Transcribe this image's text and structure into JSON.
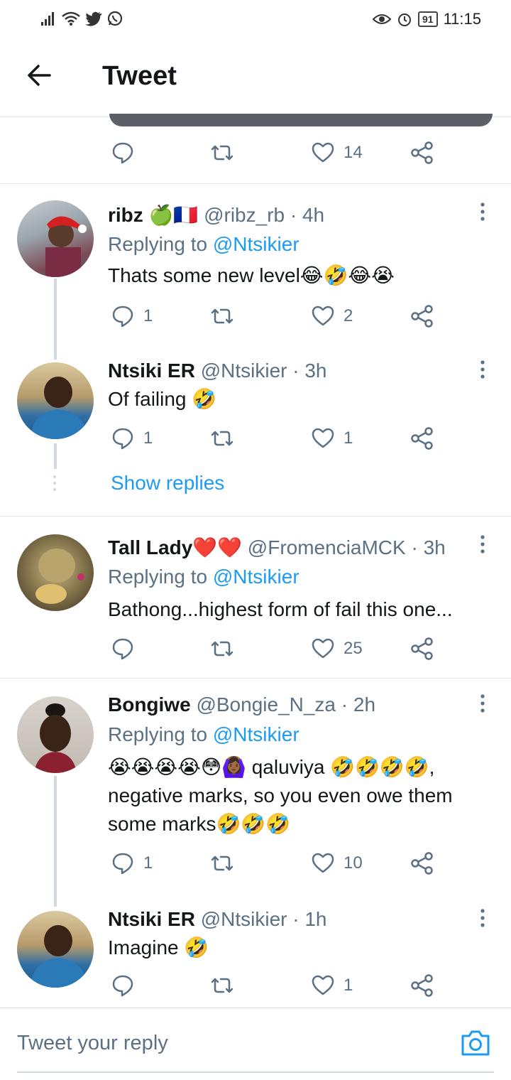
{
  "status_bar": {
    "battery": "91",
    "time": "11:15"
  },
  "header": {
    "title": "Tweet"
  },
  "top_actions": {
    "likes": "14"
  },
  "tweets": [
    {
      "name": "ribz 🍏🇫🇷",
      "handle": "@ribz_rb · 4h",
      "replying_prefix": "Replying to",
      "replying_to": "@Ntsikier",
      "text": "Thats some new level😂🤣😂😭",
      "replies": "1",
      "likes": "2"
    },
    {
      "name": "Ntsiki ER",
      "handle": "@Ntsikier · 3h",
      "text": "Of failing 🤣",
      "replies": "1",
      "likes": "1"
    },
    {
      "name": "Tall Lady❤️❤️",
      "handle": "@FromenciaMCK · 3h",
      "replying_prefix": "Replying to",
      "replying_to": "@Ntsikier",
      "text": "Bathong...highest form of fail this one...",
      "replies": "",
      "likes": "25"
    },
    {
      "name": "Bongiwe",
      "handle": "@Bongie_N_za · 2h",
      "replying_prefix": "Replying to",
      "replying_to": "@Ntsikier",
      "text": "😭😭😭😭😳🙆🏾‍♀️ qaluviya 🤣🤣🤣🤣, negative marks, so you even owe them some marks🤣🤣🤣",
      "replies": "1",
      "likes": "10"
    },
    {
      "name": "Ntsiki ER",
      "handle": "@Ntsikier · 1h",
      "text": "Imagine 🤣",
      "replies": "",
      "likes": "1"
    }
  ],
  "show_replies_label": "Show replies",
  "reply_box": {
    "placeholder": "Tweet your reply"
  },
  "colors": {
    "accent": "#1d9bf0",
    "muted": "#5b7083",
    "divider": "#e1e8ed"
  }
}
